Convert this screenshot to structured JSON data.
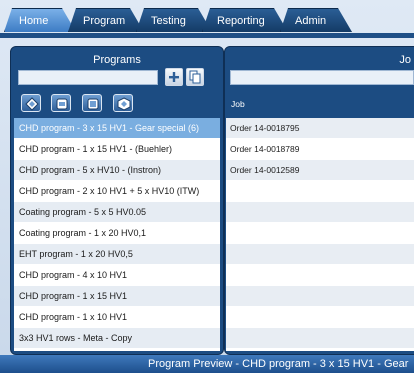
{
  "tabs": [
    {
      "label": "Home"
    },
    {
      "label": "Program"
    },
    {
      "label": "Testing"
    },
    {
      "label": "Reporting"
    },
    {
      "label": "Admin"
    }
  ],
  "programs_panel": {
    "title": "Programs",
    "search_value": "",
    "items": [
      {
        "label": "CHD program - 3 x 15 HV1 - Gear special (6)"
      },
      {
        "label": "CHD program - 1 x 15 HV1 - (Buehler)"
      },
      {
        "label": "CHD program - 5 x HV10 - (Instron)"
      },
      {
        "label": "CHD program - 2 x 10 HV1 + 5 x HV10 (ITW)"
      },
      {
        "label": "Coating program - 5 x 5 HV0.05"
      },
      {
        "label": "Coating program - 1 x 20 HV0,1"
      },
      {
        "label": "EHT program - 1 x 20 HV0,5"
      },
      {
        "label": "CHD program - 4 x 10 HV1"
      },
      {
        "label": "CHD program - 1 x 15 HV1"
      },
      {
        "label": "CHD program - 1 x 10 HV1"
      },
      {
        "label": "3x3 HV1 rows - Meta - Copy"
      }
    ]
  },
  "jobs_panel": {
    "title": "Jo",
    "column_header": "Job",
    "rows": [
      {
        "job": "Order 14-0018795"
      },
      {
        "job": "Order 14-0018789"
      },
      {
        "job": "Order 14-0012589"
      }
    ]
  },
  "footer": {
    "text": "Program Preview - CHD program - 3 x 15 HV1 - Gear"
  },
  "colors": {
    "accent": "#1c4c82",
    "selected_row": "#7aaee0",
    "active_tab": "#5f99d6"
  }
}
